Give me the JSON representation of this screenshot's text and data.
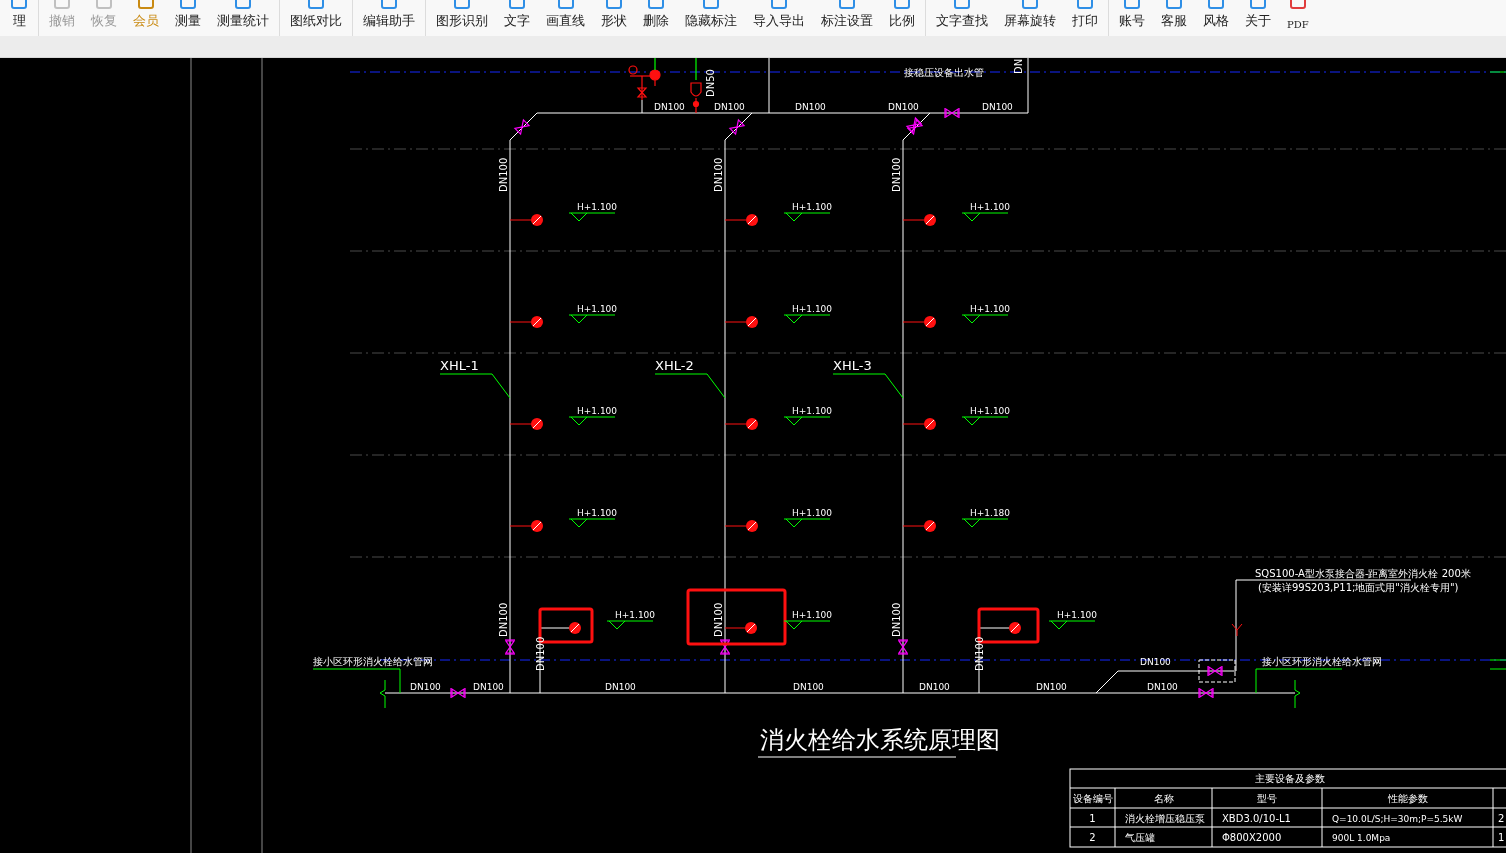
{
  "toolbar": {
    "groups": [
      [
        {
          "label": "理",
          "disabled": false,
          "highlighted": false
        }
      ],
      [
        {
          "label": "撤销",
          "disabled": true,
          "highlighted": false
        },
        {
          "label": "恢复",
          "disabled": true,
          "highlighted": false
        },
        {
          "label": "会员",
          "disabled": false,
          "highlighted": true
        },
        {
          "label": "测量",
          "disabled": false,
          "highlighted": false
        },
        {
          "label": "测量统计",
          "disabled": false,
          "highlighted": false
        }
      ],
      [
        {
          "label": "图纸对比",
          "disabled": false,
          "highlighted": false
        }
      ],
      [
        {
          "label": "编辑助手",
          "disabled": false,
          "highlighted": false
        }
      ],
      [
        {
          "label": "图形识别",
          "disabled": false,
          "highlighted": false
        },
        {
          "label": "文字",
          "disabled": false,
          "highlighted": false
        },
        {
          "label": "画直线",
          "disabled": false,
          "highlighted": false
        },
        {
          "label": "形状",
          "disabled": false,
          "highlighted": false
        },
        {
          "label": "删除",
          "disabled": false,
          "highlighted": false
        },
        {
          "label": "隐藏标注",
          "disabled": false,
          "highlighted": false
        },
        {
          "label": "导入导出",
          "disabled": false,
          "highlighted": false
        },
        {
          "label": "标注设置",
          "disabled": false,
          "highlighted": false
        },
        {
          "label": "比例",
          "disabled": false,
          "highlighted": false
        }
      ],
      [
        {
          "label": "文字查找",
          "disabled": false,
          "highlighted": false
        },
        {
          "label": "屏幕旋转",
          "disabled": false,
          "highlighted": false
        },
        {
          "label": "打印",
          "disabled": false,
          "highlighted": false
        }
      ],
      [
        {
          "label": "账号",
          "disabled": false,
          "highlighted": false
        },
        {
          "label": "客服",
          "disabled": false,
          "highlighted": false
        },
        {
          "label": "风格",
          "disabled": false,
          "highlighted": false
        },
        {
          "label": "关于",
          "disabled": false,
          "highlighted": false
        },
        {
          "label": "PDF",
          "disabled": false,
          "highlighted": false
        }
      ]
    ]
  },
  "drawing": {
    "top_pipe_labels": [
      "DN100",
      "DN100",
      "DN100",
      "DN100",
      "DN100"
    ],
    "top_branch_label": "DN50",
    "top_edge_label": "DN",
    "top_note": "接稳压设备出水管",
    "risers": [
      {
        "label": "XHL-1",
        "upper_size": "DN100",
        "lower_size": "DN100",
        "elevations": [
          "H+1.100",
          "H+1.100",
          "H+1.100",
          "H+1.100"
        ]
      },
      {
        "label": "XHL-2",
        "upper_size": "DN100",
        "lower_size": "DN100",
        "elevations": [
          "H+1.100",
          "H+1.100",
          "H+1.100",
          "H+1.100"
        ]
      },
      {
        "label": "XHL-3",
        "upper_size": "DN100",
        "lower_size": "DN100",
        "elevations": [
          "H+1.100",
          "H+1.100",
          "H+1.100",
          "H+1.180"
        ]
      }
    ],
    "ground_hydrants": [
      {
        "pipe_size": "DN100",
        "elevation": "H+1.100",
        "highlighted": true
      },
      {
        "elevation": "H+1.100",
        "highlighted": true
      },
      {
        "pipe_size": "DN100",
        "elevation": "H+1.100",
        "highlighted": true
      }
    ],
    "main_labels": [
      "DN100",
      "DN100",
      "DN100",
      "DN100",
      "DN100",
      "DN100",
      "DN100"
    ],
    "branch_label": "DN100",
    "inlet_notes": [
      "接小区环形消火栓给水管网",
      "接小区环形消火栓给水管网"
    ],
    "connector_note": [
      "SQS100-A型水泵接合器-距离室外消火栓 200米",
      "(安装详99S203,P11;地面式用\"消火栓专用\")"
    ],
    "title": "消火栓给水系统原理图",
    "table": {
      "title": "主要设备及参数",
      "columns": [
        "设备编号",
        "名称",
        "型号",
        "性能参数"
      ],
      "rows": [
        {
          "cells": [
            "1",
            "消火栓增压稳压泵",
            "XBD3.0/10-L1",
            "Q=10.0L/S;H=30m;P=5.5kW",
            "2"
          ]
        },
        {
          "cells": [
            "2",
            "气压罐",
            "Φ800X2000",
            "900L 1.0Mpa",
            "1"
          ]
        }
      ]
    }
  }
}
